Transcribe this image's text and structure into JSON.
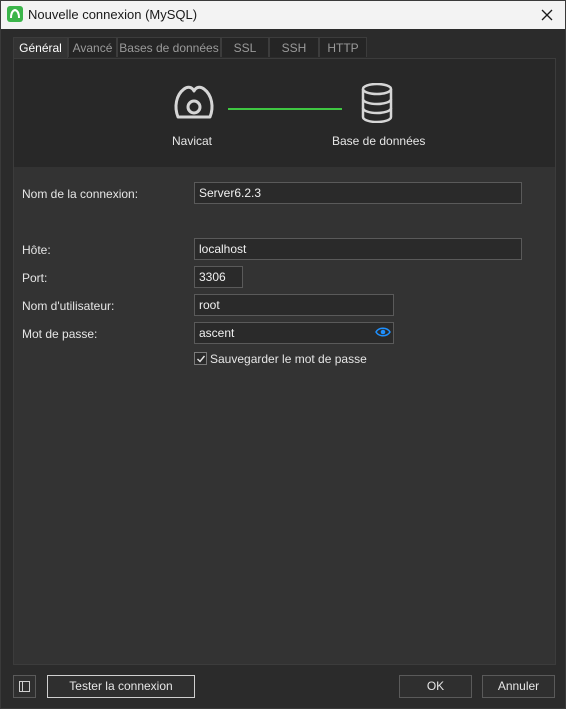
{
  "window": {
    "title": "Nouvelle connexion (MySQL)"
  },
  "tabs": [
    {
      "label": "Général"
    },
    {
      "label": "Avancé"
    },
    {
      "label": "Bases de données"
    },
    {
      "label": "SSL"
    },
    {
      "label": "SSH"
    },
    {
      "label": "HTTP"
    }
  ],
  "active_tab": "Général",
  "header": {
    "left_caption": "Navicat",
    "right_caption": "Base de données",
    "connector_color": "#3fc742"
  },
  "form": {
    "connection_name": {
      "label": "Nom de la connexion:",
      "value": "Server6.2.3"
    },
    "host": {
      "label": "Hôte:",
      "value": "localhost"
    },
    "port": {
      "label": "Port:",
      "value": "3306"
    },
    "username": {
      "label": "Nom d'utilisateur:",
      "value": "root"
    },
    "password": {
      "label": "Mot de passe:",
      "value": "ascent"
    },
    "save_password": {
      "label": "Sauvegarder le mot de passe",
      "checked": true
    }
  },
  "footer": {
    "test_label": "Tester la connexion",
    "ok_label": "OK",
    "cancel_label": "Annuler"
  },
  "colors": {
    "accent_blue": "#1e90ff",
    "brand_green": "#3bb54a"
  }
}
